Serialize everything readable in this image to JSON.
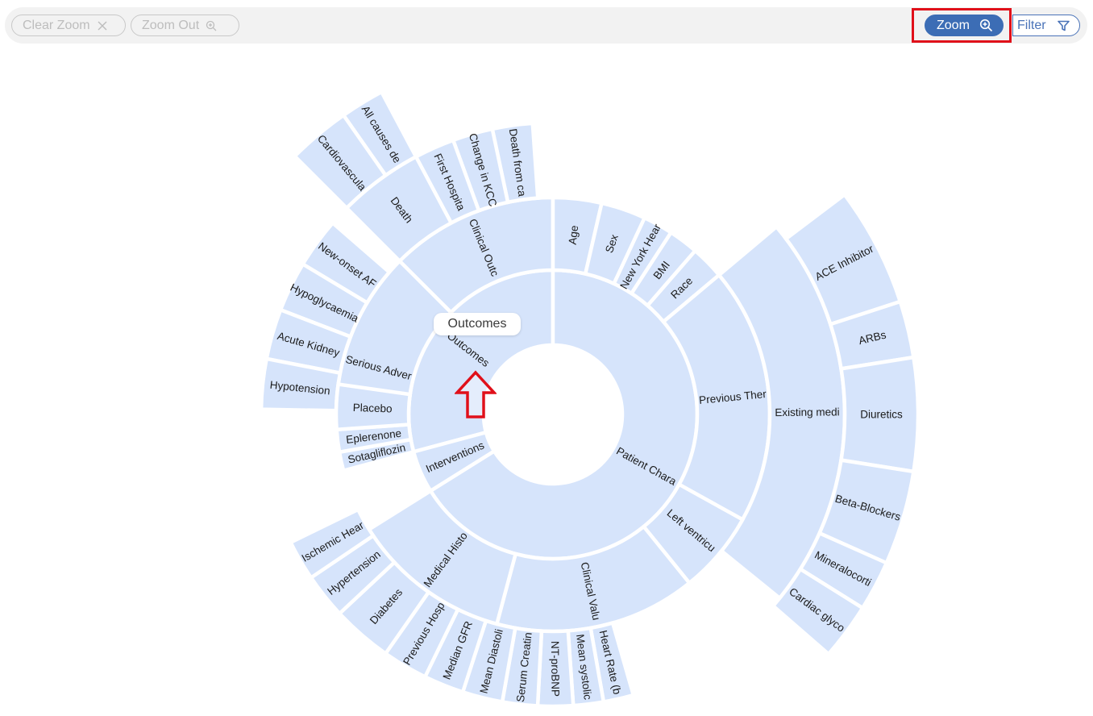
{
  "toolbar": {
    "clear_zoom_label": "Clear Zoom",
    "zoom_out_label": "Zoom Out",
    "zoom_label": "Zoom",
    "filter_label": "Filter",
    "colors": {
      "zoom_bg": "#3c6db5",
      "filter_accent": "#4a73b8",
      "disabled_text": "#bdbdbd",
      "highlight": "#e0101a"
    }
  },
  "tooltip": {
    "text": "Outcomes"
  },
  "sunburst": {
    "segment_color": "#d6e4fb",
    "center_label": "Outcomes",
    "root": [
      {
        "name": "Outcomes",
        "children": [
          {
            "name": "Clinical Outc",
            "children": [
              {
                "name": "Death from ca"
              },
              {
                "name": "Change in KCC"
              },
              {
                "name": "First Hospita"
              },
              {
                "name": "Death",
                "children": [
                  {
                    "name": "All causes de"
                  },
                  {
                    "name": "Cardiovascula"
                  }
                ]
              }
            ]
          },
          {
            "name": "Serious Adver",
            "children": [
              {
                "name": "New-onset AF"
              },
              {
                "name": "Hypoglycaemia"
              },
              {
                "name": "Acute Kidney"
              },
              {
                "name": "Hypotension"
              }
            ]
          }
        ]
      },
      {
        "name": "Interventions",
        "children": [
          {
            "name": "Sotagliflozin"
          },
          {
            "name": "Eplerenone"
          },
          {
            "name": "Placebo"
          }
        ]
      },
      {
        "name": "Patient Chara",
        "children": [
          {
            "name": "Age"
          },
          {
            "name": "Sex"
          },
          {
            "name": "New York Hear"
          },
          {
            "name": "BMI"
          },
          {
            "name": "Race"
          },
          {
            "name": "Previous Ther",
            "children": [
              {
                "name": "Existing medi",
                "children": [
                  {
                    "name": "ACE Inhibitor"
                  },
                  {
                    "name": "ARBs"
                  },
                  {
                    "name": "Diuretics"
                  },
                  {
                    "name": "Beta-Blockers"
                  },
                  {
                    "name": "Mineralocorti"
                  },
                  {
                    "name": "Cardiac glyco"
                  }
                ]
              }
            ]
          },
          {
            "name": "Left ventricu"
          },
          {
            "name": "Clinical Valu",
            "children": [
              {
                "name": "Heart Rate (b"
              },
              {
                "name": "Mean systolic"
              },
              {
                "name": "NT-proBNP"
              },
              {
                "name": "Serum Creatin"
              },
              {
                "name": "Mean Diastoli"
              },
              {
                "name": "Median GFR"
              }
            ]
          },
          {
            "name": "Medical Histo",
            "children": [
              {
                "name": "Previous Hosp"
              },
              {
                "name": "Diabetes"
              },
              {
                "name": "Hypertension"
              },
              {
                "name": "Ischemic Hear"
              }
            ]
          }
        ]
      }
    ]
  }
}
